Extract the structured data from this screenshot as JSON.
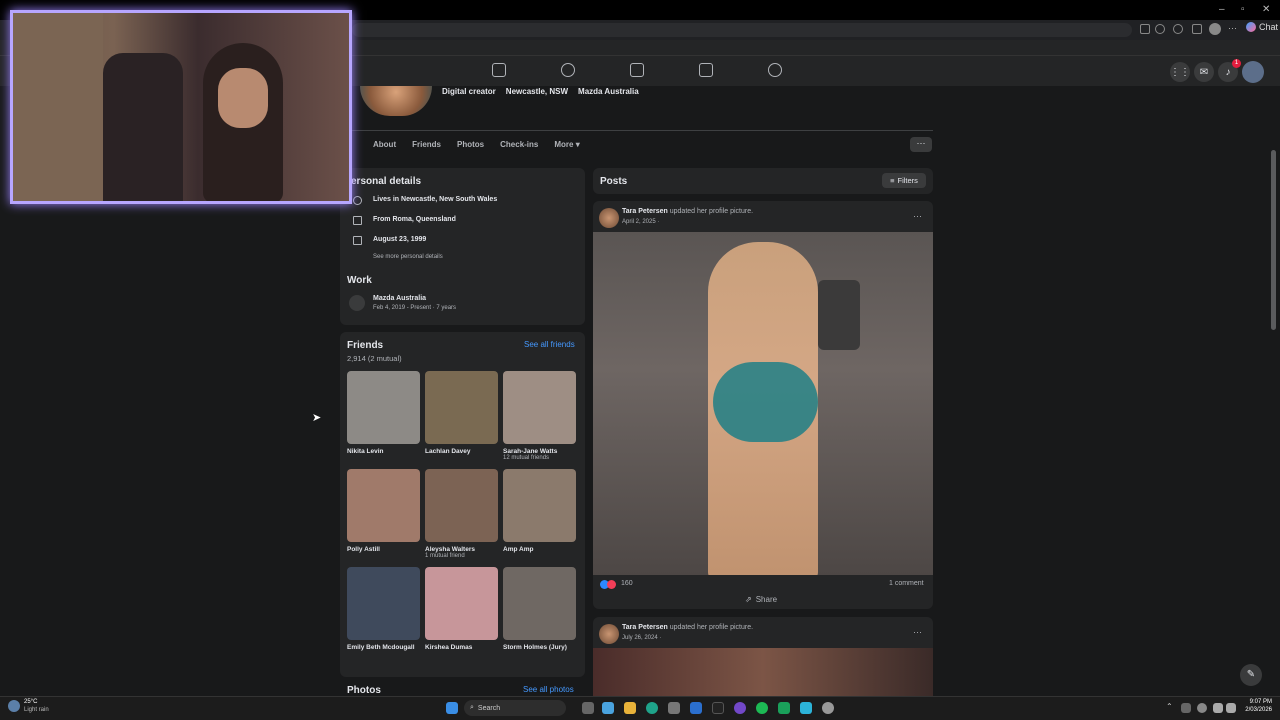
{
  "browser": {
    "chat_label": "Chat"
  },
  "profile": {
    "meta": [
      "Digital creator",
      "Newcastle, NSW",
      "Mazda Australia"
    ]
  },
  "tabs": [
    "About",
    "Friends",
    "Photos",
    "Check-ins",
    "More"
  ],
  "personal_details": {
    "title": "ersonal details",
    "lives": "Lives in Newcastle, New South Wales",
    "from": "From Roma, Queensland",
    "birthday": "August 23, 1999",
    "see_more": "See more personal details"
  },
  "work": {
    "title": "Work",
    "company": "Mazda Australia",
    "dates": "Feb 4, 2019 - Present · 7 years"
  },
  "friends": {
    "title": "Friends",
    "count": "2,914 (2 mutual)",
    "see_all": "See all friends",
    "items": [
      {
        "name": "Nikita Levin",
        "sub": "",
        "color": "#8d8a86"
      },
      {
        "name": "Lachlan Davey",
        "sub": "",
        "color": "#7a6a52"
      },
      {
        "name": "Sarah-Jane Watts",
        "sub": "12 mutual friends",
        "color": "#9e8e84"
      },
      {
        "name": "Polly Astill",
        "sub": "",
        "color": "#a07a6a"
      },
      {
        "name": "Aleysha Walters",
        "sub": "1 mutual friend",
        "color": "#7c6354"
      },
      {
        "name": "Amp Amp",
        "sub": "",
        "color": "#8b7a6c"
      },
      {
        "name": "Emily Beth Mcdougall",
        "sub": "",
        "color": "#3f4a5c"
      },
      {
        "name": "Kirshea Dumas",
        "sub": "",
        "color": "#c7969a"
      },
      {
        "name": "Storm Holmes (Jury)",
        "sub": "",
        "color": "#6f6863"
      }
    ]
  },
  "photos": {
    "title": "Photos",
    "see_all": "See all photos"
  },
  "posts": {
    "title": "Posts",
    "filters": "Filters",
    "items": [
      {
        "author": "Tara Petersen",
        "action": "updated her profile picture.",
        "date": "April 2, 2025 ·",
        "reactions": "160",
        "comments": "1 comment",
        "share": "Share"
      },
      {
        "author": "Tara Petersen",
        "action": "updated her profile picture.",
        "date": "July 26, 2024 ·"
      }
    ]
  },
  "taskbar": {
    "weather_temp": "25°C",
    "weather_desc": "Light rain",
    "search": "Search",
    "time": "9:07 PM",
    "date": "2/03/2026"
  },
  "notifications_badge": "1"
}
